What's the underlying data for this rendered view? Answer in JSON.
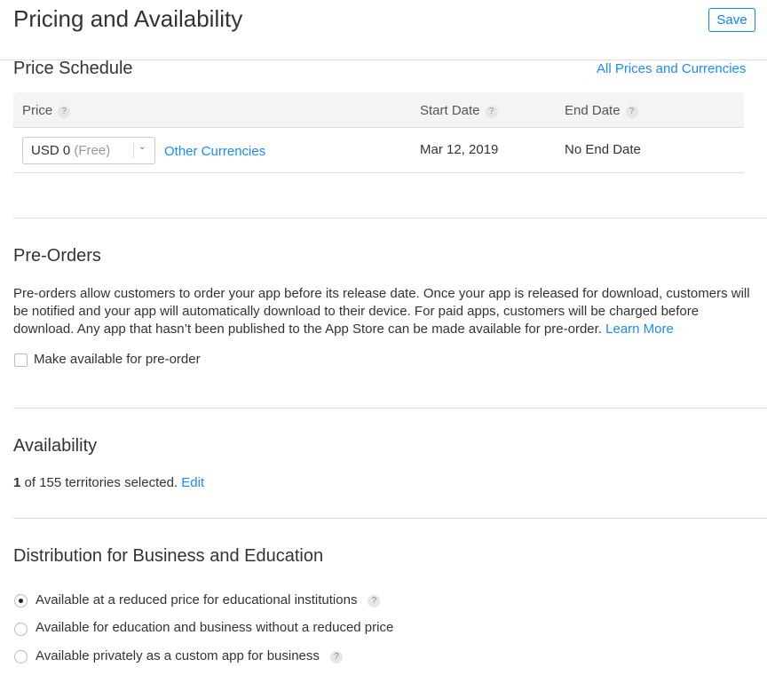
{
  "header": {
    "title": "Pricing and Availability",
    "save_label": "Save"
  },
  "price_schedule": {
    "title": "Price Schedule",
    "all_prices_link": "All Prices and Currencies",
    "columns": [
      "Price",
      "Start Date",
      "End Date"
    ],
    "help_glyph": "?",
    "row": {
      "price_value": "USD 0",
      "price_note": "(Free)",
      "other_currencies": "Other Currencies",
      "start_date": "Mar 12, 2019",
      "end_date": "No End Date"
    }
  },
  "pre_orders": {
    "title": "Pre-Orders",
    "description": "Pre-orders allow customers to order your app before its release date. Once your app is released for download, customers will be notified and your app will automatically download to their device. For paid apps, customers will be charged before download. Any app that hasn’t been published to the App Store can be made available for pre-order.",
    "learn_more": "Learn More",
    "checkbox_label": "Make available for pre-order",
    "checked": false
  },
  "availability": {
    "title": "Availability",
    "count": "1",
    "summary": " of 155 territories selected.",
    "edit": "Edit"
  },
  "distribution": {
    "title": "Distribution for Business and Education",
    "options": [
      {
        "label": "Available at a reduced price for educational institutions",
        "selected": true,
        "help": true
      },
      {
        "label": "Available for education and business without a reduced price",
        "selected": false,
        "help": false
      },
      {
        "label": "Available privately as a custom app for business",
        "selected": false,
        "help": true
      }
    ]
  },
  "colors": {
    "accent": "#1a8cff"
  }
}
